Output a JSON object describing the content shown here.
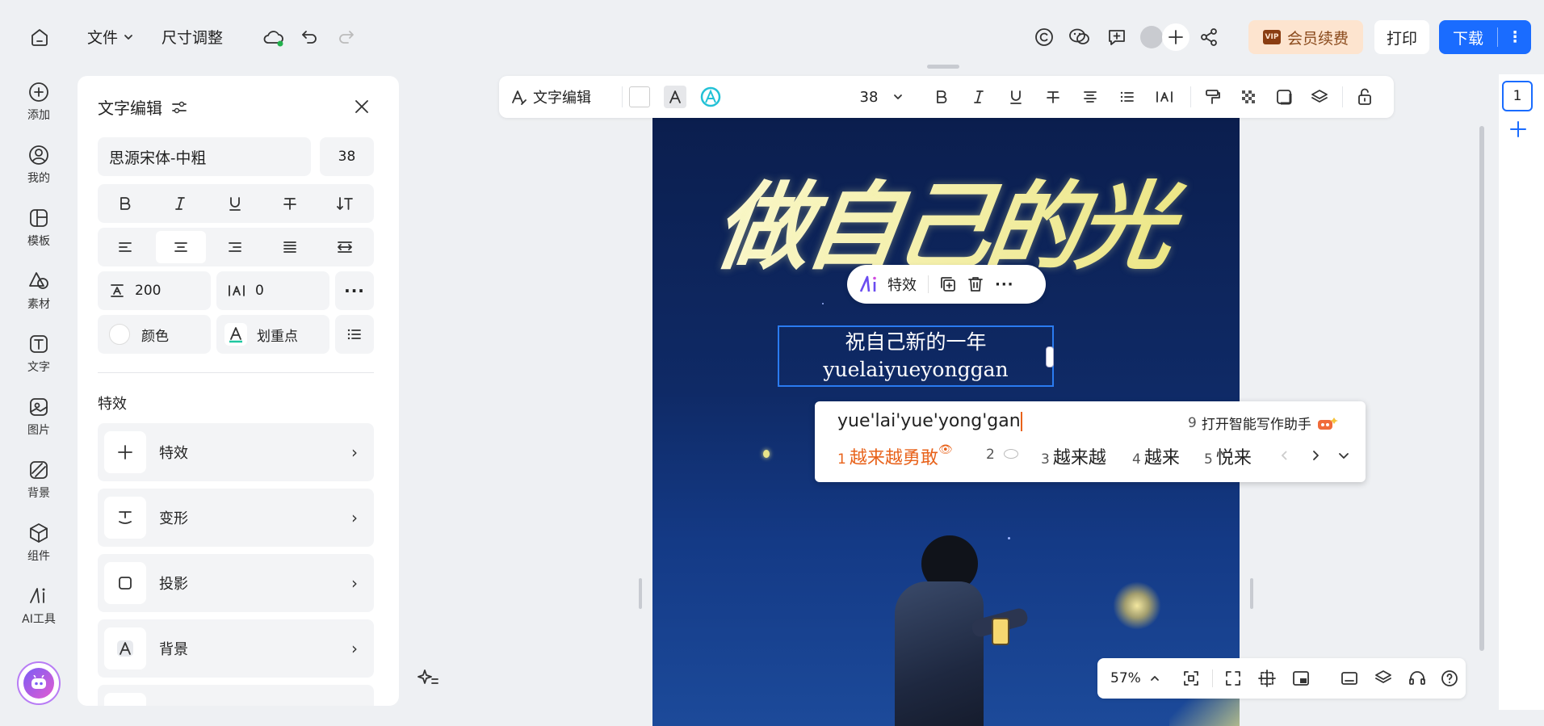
{
  "topbar": {
    "file_label": "文件",
    "resize_label": "尺寸调整",
    "vip_label": "会员续费",
    "print_label": "打印",
    "download_label": "下载"
  },
  "rail": {
    "items": [
      {
        "label": "添加",
        "icon": "plus-circle-icon"
      },
      {
        "label": "我的",
        "icon": "user-icon"
      },
      {
        "label": "模板",
        "icon": "template-icon"
      },
      {
        "label": "素材",
        "icon": "shapes-icon"
      },
      {
        "label": "文字",
        "icon": "text-icon"
      },
      {
        "label": "图片",
        "icon": "image-icon"
      },
      {
        "label": "背景",
        "icon": "background-icon"
      },
      {
        "label": "组件",
        "icon": "cube-icon"
      },
      {
        "label": "AI工具",
        "icon": "ai-icon"
      }
    ]
  },
  "panel": {
    "title": "文字编辑",
    "font_name": "思源宋体-中粗",
    "font_size": "38",
    "line_height": "200",
    "letter_spacing": "0",
    "color_label": "颜色",
    "highlight_label": "划重点",
    "effects_heading": "特效",
    "effects": [
      {
        "label": "特效",
        "icon": "plus-icon"
      },
      {
        "label": "变形",
        "icon": "warp-icon"
      },
      {
        "label": "投影",
        "icon": "shadow-icon"
      },
      {
        "label": "背景",
        "icon": "text-background-icon"
      }
    ]
  },
  "format_bar": {
    "mode_label": "文字编辑",
    "font_size": "38"
  },
  "canvas": {
    "headline": "做自己的光",
    "subtitle_line1": "祝自己新的一年",
    "subtitle_line2": "yuelaiyueyonggan",
    "float_effect_label": "特效"
  },
  "ime": {
    "pinyin": "yue'lai'yue'yong'gan",
    "assistant_num": "9",
    "assistant_label": "打开智能写作助手",
    "candidates": [
      {
        "num": "1",
        "text": "越来越勇敢"
      },
      {
        "num": "2",
        "text": ""
      },
      {
        "num": "3",
        "text": "越来越"
      },
      {
        "num": "4",
        "text": "越来"
      },
      {
        "num": "5",
        "text": "悦来"
      }
    ]
  },
  "zoom": {
    "level": "57%"
  },
  "pages": {
    "current": "1"
  },
  "colors": {
    "accent": "#1a6cff",
    "vip_bg": "#fde4cf",
    "ime_highlight": "#e8621a"
  }
}
